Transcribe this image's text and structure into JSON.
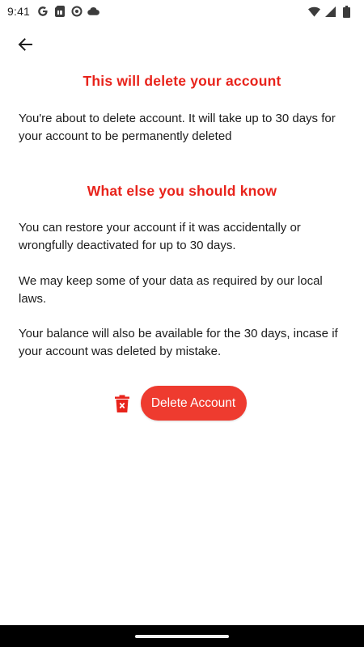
{
  "status_bar": {
    "time": "9:41",
    "left_icons": [
      "google-icon",
      "sim-card-icon",
      "sync-icon",
      "cloud-icon"
    ],
    "right_icons": [
      "wifi-icon",
      "signal-icon",
      "battery-icon"
    ]
  },
  "header": {
    "back_icon": "arrow-left-icon"
  },
  "content": {
    "title": "This will delete your account",
    "intro": "You're about to delete account. It will take up to 30 days for your account to be permanently deleted",
    "subtitle": "What else you should know",
    "paragraphs": [
      "You can restore your account if it was accidentally or wrongfully deactivated for up to 30 days.",
      "We may keep some of your data as required by our local laws.",
      "Your balance will also be available for the 30 days, incase if your account was deleted by mistake."
    ]
  },
  "actions": {
    "trash_icon": "trash-icon",
    "delete_label": "Delete Account"
  },
  "colors": {
    "accent": "#e8231b",
    "button_bg": "#ee3b2f",
    "text": "#1c1c1c",
    "nav_bar": "#000000"
  }
}
